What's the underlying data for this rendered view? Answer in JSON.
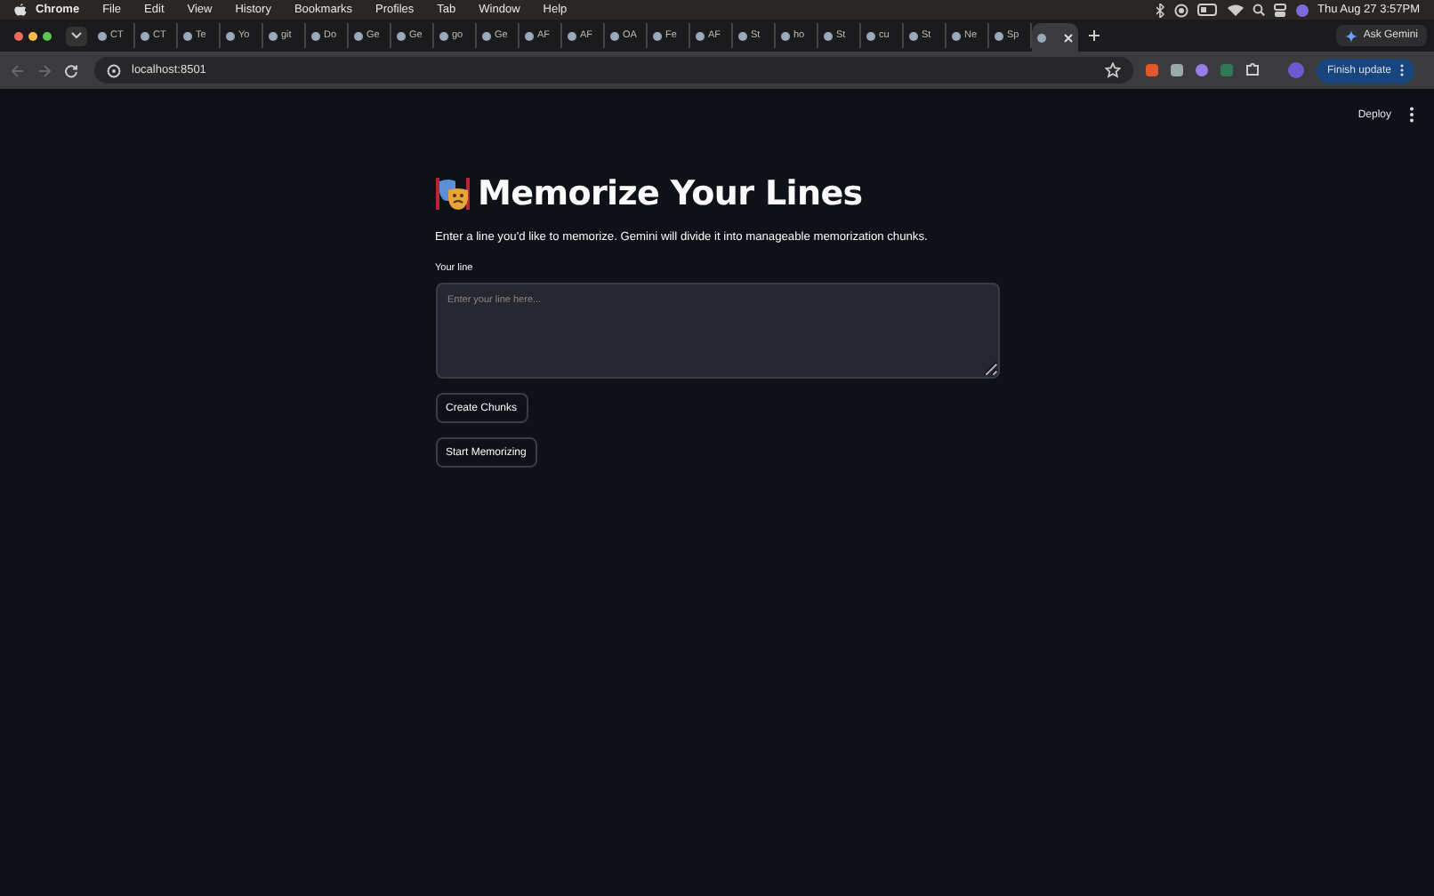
{
  "menu_bar": {
    "app": "Chrome",
    "items": [
      "File",
      "Edit",
      "View",
      "History",
      "Bookmarks",
      "Profiles",
      "Tab",
      "Window",
      "Help"
    ],
    "clock": "Thu Aug 27  3:57PM"
  },
  "tabs": [
    {
      "label": "CT",
      "selected": false
    },
    {
      "label": "CT",
      "selected": false
    },
    {
      "label": "Te",
      "selected": false
    },
    {
      "label": "Yo",
      "selected": false
    },
    {
      "label": "git",
      "selected": false
    },
    {
      "label": "Do",
      "selected": false
    },
    {
      "label": "Ge",
      "selected": false
    },
    {
      "label": "Ge",
      "selected": false
    },
    {
      "label": "go",
      "selected": false
    },
    {
      "label": "Ge",
      "selected": false
    },
    {
      "label": "AF",
      "selected": false
    },
    {
      "label": "AF",
      "selected": false
    },
    {
      "label": "OA",
      "selected": false
    },
    {
      "label": "Fe",
      "selected": false
    },
    {
      "label": "AF",
      "selected": false
    },
    {
      "label": "St",
      "selected": false
    },
    {
      "label": "ho",
      "selected": false
    },
    {
      "label": "St",
      "selected": false
    },
    {
      "label": "cu",
      "selected": false
    },
    {
      "label": "St",
      "selected": false
    },
    {
      "label": "Ne",
      "selected": false
    },
    {
      "label": "Sp",
      "selected": false
    },
    {
      "selected": true
    }
  ],
  "ask_gemini": "Ask Gemini",
  "address_bar": {
    "url": "localhost:8501"
  },
  "finish_update": "Finish update",
  "app": {
    "deploy": "Deploy",
    "title": "Memorize Your Lines",
    "description": "Enter a line you'd like to memorize. Gemini will divide it into manageable memorization chunks.",
    "field_label": "Your line",
    "placeholder": "Enter your line here...",
    "buttons": [
      "Create Chunks",
      "Start Memorizing"
    ]
  }
}
